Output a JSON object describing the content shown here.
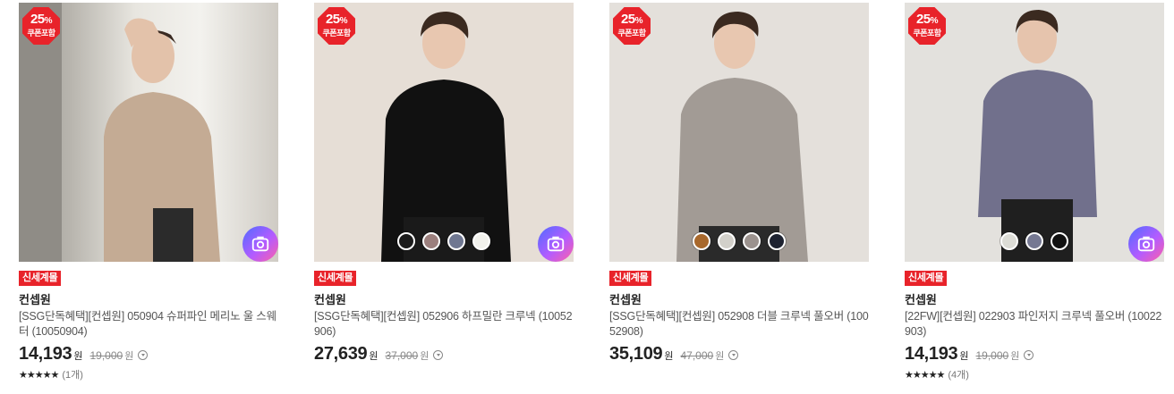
{
  "products": [
    {
      "image_alt": "050904 슈퍼파인 메리노 울 스웨터",
      "badge": {
        "percent": "25",
        "percent_unit": "%",
        "text": "쿠폰포함"
      },
      "tag": "신세계몰",
      "brand": "컨셉원",
      "name": "[SSG단독혜택][컨셉원] 050904 슈퍼파인 메리노 울 스웨터 (10050904)",
      "price": "14,193",
      "price_unit": "원",
      "original_price": "19,000",
      "original_unit": "원",
      "rating_stars": "★★★★★",
      "review_count": "(1개)",
      "swatches": [],
      "colors": {
        "bg": "#cfcac2",
        "sweater": "#c4ab94",
        "pants": "#2b2b2b"
      }
    },
    {
      "image_alt": "052906 하프밀란 크루넥",
      "badge": {
        "percent": "25",
        "percent_unit": "%",
        "text": "쿠폰포함"
      },
      "tag": "신세계몰",
      "brand": "컨셉원",
      "name": "[SSG단독혜택][컨셉원] 052906 하프밀란 크루넥 (10052906)",
      "price": "27,639",
      "price_unit": "원",
      "original_price": "37,000",
      "original_unit": "원",
      "rating_stars": "",
      "review_count": "",
      "swatches": [
        "#1c1c1c",
        "#9b7f7d",
        "#6f7791",
        "#f1f1ec"
      ],
      "colors": {
        "bg": "#e6ded6",
        "sweater": "#111111",
        "pants": "#1a1a1a"
      }
    },
    {
      "image_alt": "052908 더블 크루넥 풀오버",
      "badge": {
        "percent": "25",
        "percent_unit": "%",
        "text": "쿠폰포함"
      },
      "tag": "신세계몰",
      "brand": "컨셉원",
      "name": "[SSG단독혜택][컨셉원] 052908 더블 크루넥 풀오버 (10052908)",
      "price": "35,109",
      "price_unit": "원",
      "original_price": "47,000",
      "original_unit": "원",
      "rating_stars": "",
      "review_count": "",
      "swatches": [
        "#a8682c",
        "#d2d0ca",
        "#9b928e",
        "#1d2230"
      ],
      "colors": {
        "bg": "#e4e0db",
        "sweater": "#a29b95",
        "pants": "#2a2a2a"
      }
    },
    {
      "image_alt": "022903 파인저지 크루넥 풀오버",
      "badge": {
        "percent": "25",
        "percent_unit": "%",
        "text": "쿠폰포함"
      },
      "tag": "신세계몰",
      "brand": "컨셉원",
      "name": "[22FW][컨셉원] 022903 파인저지 크루넥 풀오버 (10022903)",
      "price": "14,193",
      "price_unit": "원",
      "original_price": "19,000",
      "original_unit": "원",
      "rating_stars": "★★★★★",
      "review_count": "(4개)",
      "swatches": [
        "#dcdcd6",
        "#757892",
        "#111111"
      ],
      "colors": {
        "bg": "#e3e1dd",
        "sweater": "#71708c",
        "pants": "#1f1f1f"
      }
    }
  ]
}
